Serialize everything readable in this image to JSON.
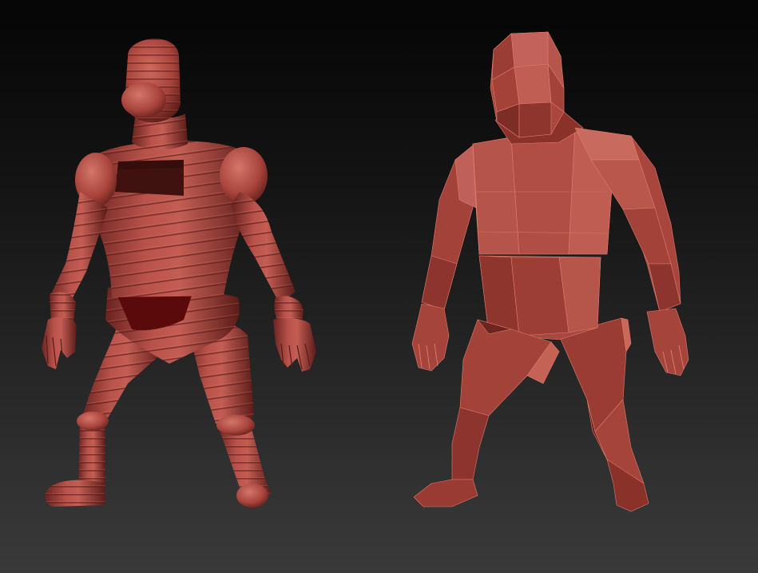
{
  "viewport": {
    "background_top": "#050505",
    "background_bottom": "#3a3a3a"
  },
  "models": [
    {
      "id": "banded-mannequin",
      "style": "smooth-banded",
      "base_color": "#a8413a"
    },
    {
      "id": "lowpoly-mannequin",
      "style": "faceted-low-poly",
      "base_color": "#a84a40"
    }
  ],
  "palette": {
    "base": "#a8443c",
    "highlight": "#d9776a",
    "shadow": "#5e1c18",
    "deep": "#3f0d0b",
    "band_line": "#6e2420",
    "facet_line": "#f08a78"
  }
}
